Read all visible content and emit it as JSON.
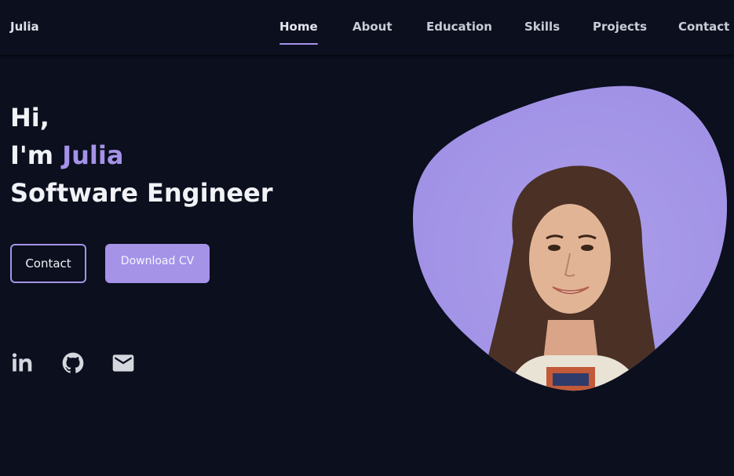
{
  "nav": {
    "brand": "Julia",
    "links": [
      {
        "label": "Home",
        "active": true
      },
      {
        "label": "About",
        "active": false
      },
      {
        "label": "Education",
        "active": false
      },
      {
        "label": "Skills",
        "active": false
      },
      {
        "label": "Projects",
        "active": false
      },
      {
        "label": "Contact",
        "active": false
      }
    ]
  },
  "hero": {
    "greeting": "Hi,",
    "intro_prefix": "I'm",
    "name": "Julia",
    "title": "Software Engineer",
    "contact_label": "Contact",
    "download_label": "Download CV"
  },
  "social": [
    {
      "icon": "linkedin-icon"
    },
    {
      "icon": "github-icon"
    },
    {
      "icon": "mail-icon"
    }
  ],
  "colors": {
    "background": "#0b0f1e",
    "accent": "#a593e8",
    "text": "#f1f2f6"
  }
}
